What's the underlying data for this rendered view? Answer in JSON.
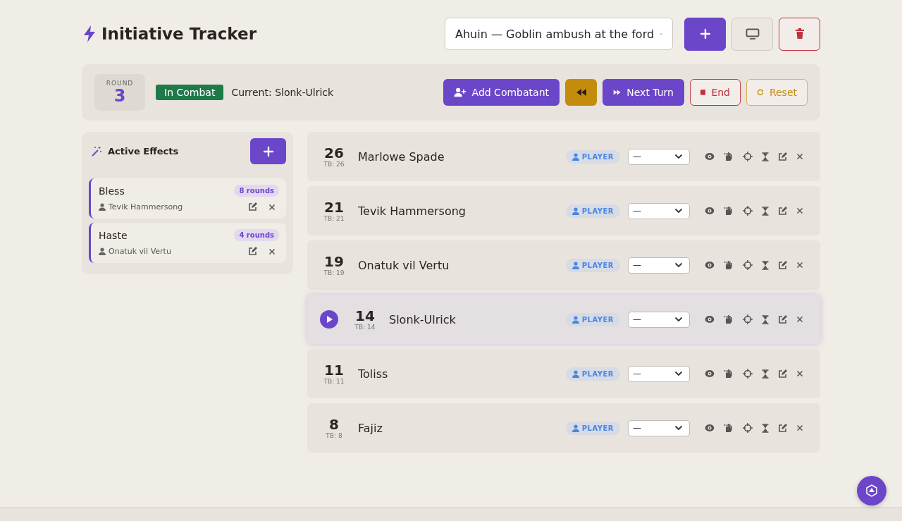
{
  "header": {
    "title": "Initiative Tracker",
    "session": {
      "value": "Ahuin — Goblin ambush at the ford"
    }
  },
  "combat_bar": {
    "round_label": "ROUND",
    "round": "3",
    "status": "In Combat",
    "current_label": "Current: Slonk-Ulrick",
    "buttons": [
      {
        "kind": "add",
        "label": "Add Combatant"
      },
      {
        "kind": "previous"
      },
      {
        "kind": "next",
        "label": "Next Turn"
      },
      {
        "kind": "end",
        "label": "End"
      },
      {
        "kind": "reset",
        "label": "Reset"
      }
    ]
  },
  "effects": {
    "title": "Active Effects",
    "items": [
      {
        "name": "Bless",
        "duration": "8 rounds",
        "target": "Tevik Hammersong"
      },
      {
        "name": "Haste",
        "duration": "4 rounds",
        "target": "Onatuk vil Vertu"
      }
    ]
  },
  "combatants": [
    {
      "initiative": "26",
      "tiebreak": "TB: 26",
      "name": "Marlowe Spade",
      "type": "PLAYER",
      "condition": "—",
      "current": false
    },
    {
      "initiative": "21",
      "tiebreak": "TB: 21",
      "name": "Tevik Hammersong",
      "type": "PLAYER",
      "condition": "—",
      "current": false
    },
    {
      "initiative": "19",
      "tiebreak": "TB: 19",
      "name": "Onatuk vil Vertu",
      "type": "PLAYER",
      "condition": "—",
      "current": false
    },
    {
      "initiative": "14",
      "tiebreak": "TB: 14",
      "name": "Slonk-Ulrick",
      "type": "PLAYER",
      "condition": "—",
      "current": true
    },
    {
      "initiative": "11",
      "tiebreak": "TB: 11",
      "name": "Toliss",
      "type": "PLAYER",
      "condition": "—",
      "current": false
    },
    {
      "initiative": "8",
      "tiebreak": "TB: 8",
      "name": "Fajiz",
      "type": "PLAYER",
      "condition": "—",
      "current": false
    }
  ]
}
